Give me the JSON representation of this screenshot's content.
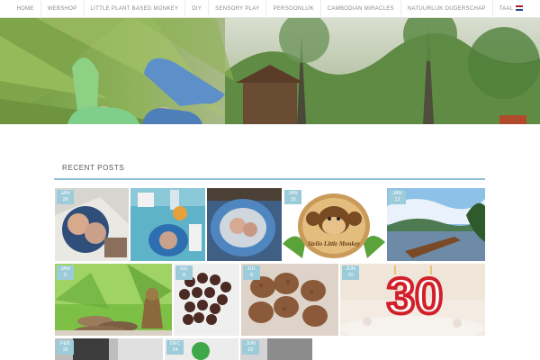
{
  "nav": {
    "items": [
      "HOME",
      "WEBSHOP",
      "LITTLE PLANT BASED MONKEY",
      "DIY",
      "SENSORY PLAY",
      "PERSOONLIJK",
      "CAMBODIAN MIRACLES",
      "NATUURLIJK OUDERSCHAP",
      "TAAL"
    ]
  },
  "section": {
    "title": "RECENT POSTS"
  },
  "posts": [
    {
      "month": "JAN",
      "day": "28",
      "image": "baby-photo-collage"
    },
    {
      "month": "",
      "day": "",
      "image": "blue-plate-craft-table"
    },
    {
      "month": "",
      "day": "",
      "image": "baby-photo-on-plate"
    },
    {
      "month": "JAN",
      "day": "19",
      "image": "stelio-little-monkey-logo",
      "logo_text": "Stelio Little Monkey"
    },
    {
      "month": "JAN",
      "day": "12",
      "image": "river-boat-landscape"
    },
    {
      "month": "JAN",
      "day": "9",
      "image": "buddha-stones-quote"
    },
    {
      "month": "JUL",
      "day": "8",
      "image": "chocolate-truffles"
    },
    {
      "month": "JUL",
      "day": "8",
      "image": "chocolate-cookies"
    },
    {
      "month": "JUN",
      "day": "20",
      "image": "birthday-cake-30",
      "cake_number": "30"
    },
    {
      "month": "FEB",
      "day": "16",
      "image": "black-white-photo"
    },
    {
      "month": "DEC",
      "day": "24",
      "image": "green-christmas-photo"
    },
    {
      "month": "JUN",
      "day": "22",
      "image": "grey-photo"
    }
  ],
  "colors": {
    "accent": "#9ccbd9",
    "rule": "#8fc1d8",
    "nav_text": "#8a8a8a"
  }
}
